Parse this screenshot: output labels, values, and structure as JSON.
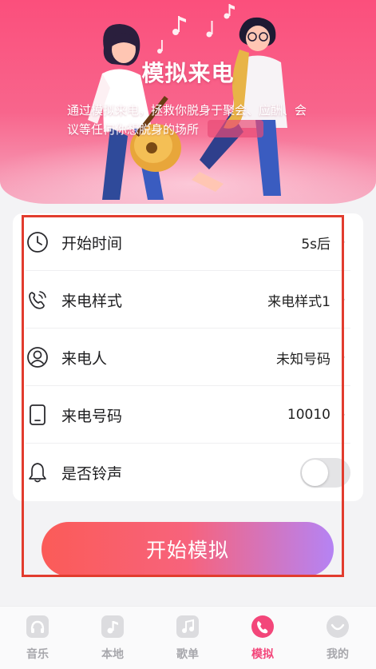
{
  "hero": {
    "title": "模拟来电",
    "description": "通过模拟来电，拯救你脱身于聚会、应酬、会议等任何你想脱身的场所"
  },
  "settings": [
    {
      "label": "开始时间",
      "value": "5s后",
      "icon": "clock-icon"
    },
    {
      "label": "来电样式",
      "value": "来电样式1",
      "icon": "phone-call-icon"
    },
    {
      "label": "来电人",
      "value": "未知号码",
      "icon": "person-icon"
    },
    {
      "label": "来电号码",
      "value": "10010",
      "icon": "mobile-phone-icon"
    },
    {
      "label": "是否铃声",
      "toggle_on": false,
      "icon": "bell-icon"
    }
  ],
  "start_button": {
    "label": "开始模拟"
  },
  "tabs": [
    {
      "label": "音乐",
      "icon": "music-app-icon",
      "active": false
    },
    {
      "label": "本地",
      "icon": "local-music-icon",
      "active": false
    },
    {
      "label": "歌单",
      "icon": "playlist-icon",
      "active": false
    },
    {
      "label": "模拟",
      "icon": "phone-icon",
      "active": true
    },
    {
      "label": "我的",
      "icon": "profile-icon",
      "active": false
    }
  ],
  "colors": {
    "accent": "#f3467a",
    "hero_pink": "#fb4f7c",
    "button_start": "#fb5b58",
    "button_end": "#b583f4",
    "annotation_red": "#e23c2e"
  }
}
